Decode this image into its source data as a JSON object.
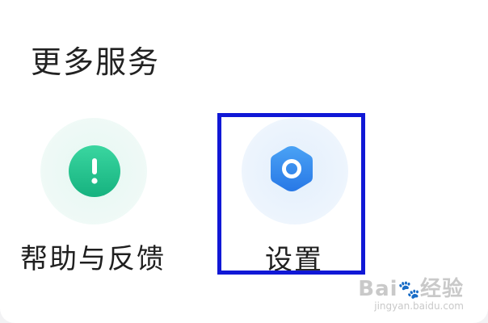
{
  "section": {
    "title": "更多服务"
  },
  "services": {
    "help": {
      "label": "帮助与反馈",
      "icon": "exclamation-icon",
      "color": "#22c08e"
    },
    "settings": {
      "label": "设置",
      "icon": "hexagon-gear-icon",
      "color": "#2f8cf0"
    }
  },
  "watermark": {
    "brand": "Bai",
    "brand_suffix": "经验",
    "url": "jingyan.baidu.com"
  }
}
